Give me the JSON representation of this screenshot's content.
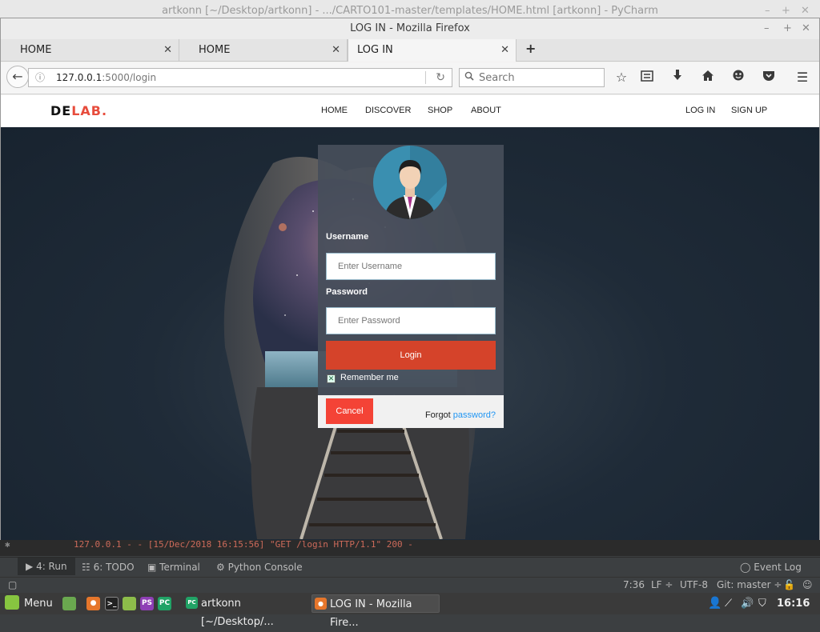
{
  "pycharm": {
    "title": "artkonn [~/Desktop/artkonn] - .../CARTO101-master/templates/HOME.html [artkonn] - PyCharm",
    "console_line": "127.0.0.1 - - [15/Dec/2018 16:15:56] \"GET /login HTTP/1.1\" 200 -",
    "tool_windows": {
      "run": "4: Run",
      "todo": "6: TODO",
      "terminal": "Terminal",
      "python_console": "Python Console",
      "event_log": "Event Log"
    },
    "status": {
      "position": "7:36",
      "line_sep": "LF ÷",
      "encoding": "UTF-8",
      "git": "Git: master ÷"
    }
  },
  "firefox": {
    "window_title": "LOG IN - Mozilla Firefox",
    "tabs": [
      {
        "label": "HOME"
      },
      {
        "label": "HOME"
      },
      {
        "label": "LOG IN"
      }
    ],
    "url_host": "127.0.0.1",
    "url_rest": ":5000/login",
    "search_placeholder": "Search"
  },
  "site": {
    "logo_a": "DE",
    "logo_b": "LAB.",
    "nav": [
      "HOME",
      "DISCOVER",
      "SHOP",
      "ABOUT"
    ],
    "login_link": "LOG IN",
    "signup_link": "SIGN UP"
  },
  "login": {
    "username_label": "Username",
    "username_placeholder": "Enter Username",
    "password_label": "Password",
    "password_placeholder": "Enter Password",
    "login_button": "Login",
    "remember_label": "Remember me",
    "remember_checked": true,
    "cancel_button": "Cancel",
    "forgot_prefix": "Forgot",
    "forgot_link": "password?"
  },
  "taskbar": {
    "menu": "Menu",
    "tasks": [
      "artkonn [~/Desktop/...",
      "LOG IN - Mozilla Fire..."
    ],
    "clock": "16:16"
  },
  "colors": {
    "accent_red": "#d5432a",
    "cancel_red": "#f44336",
    "link_blue": "#2196f3",
    "logo_red": "#e74c3c"
  }
}
